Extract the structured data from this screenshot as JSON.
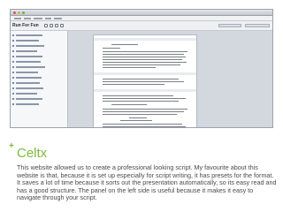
{
  "screenshot": {
    "document_title": "Run For Fun",
    "colors": {
      "accent": "#7dbb3c",
      "navigator_bullet": "#6b86b5"
    },
    "icons": [
      "bold-icon",
      "italic-icon",
      "underline-icon",
      "print-icon"
    ],
    "navigator_item_count": 14
  },
  "slide": {
    "plus": "+",
    "heading": "Celtx",
    "caption": "This website allowed us to create a professional looking script. My favourite about this website is that, because it is set up especially for script writing, it has presets for the format. It saves a lot of time because it sorts out the presentation automatically, so its easy read and has a good structure. The panel on the left side is useful because it makes it easy to navigate through your script."
  }
}
